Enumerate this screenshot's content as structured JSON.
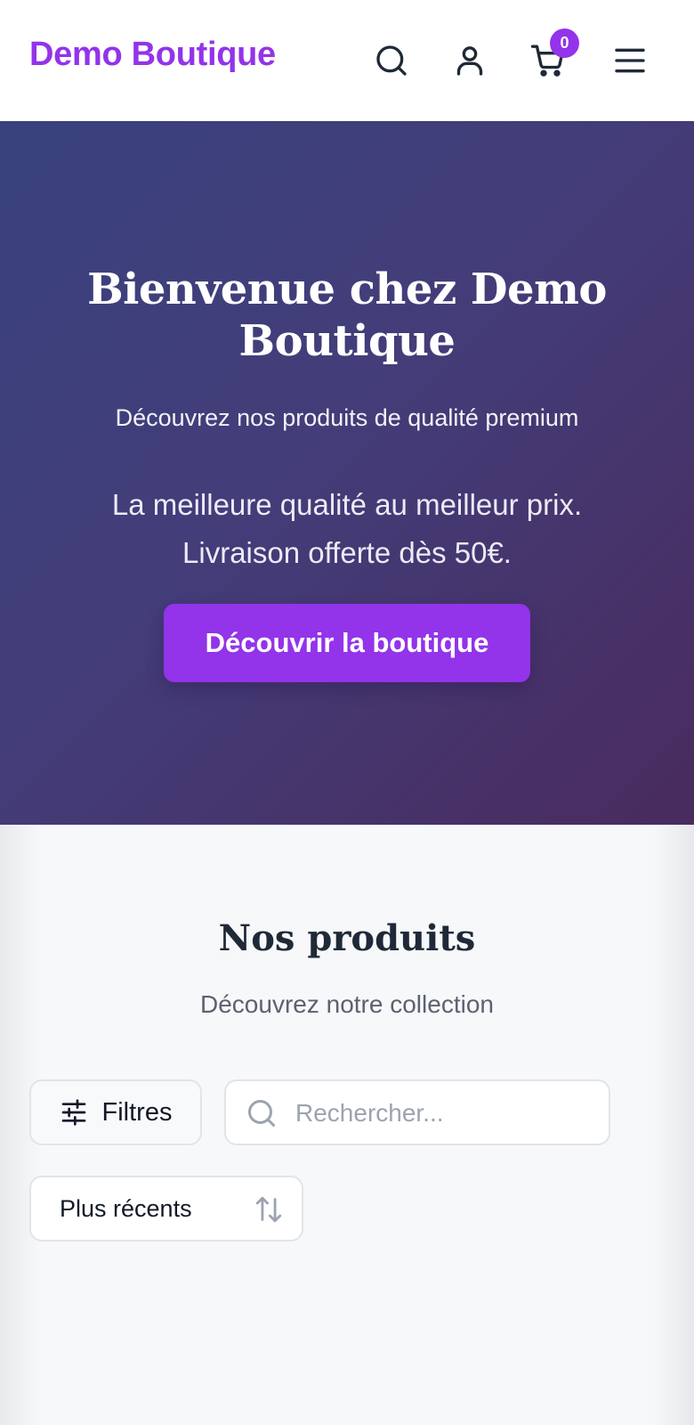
{
  "header": {
    "brand": "Demo Boutique",
    "cart_count": "0",
    "icons": [
      "search-icon",
      "user-icon",
      "cart-icon",
      "menu-icon"
    ]
  },
  "hero": {
    "title": "Bienvenue chez Demo Boutique",
    "subtitle": "Découvrez nos produits de qualité premium",
    "text": "La meilleure qualité au meilleur prix. Livraison offerte dès 50€.",
    "cta_label": "Découvrir la boutique"
  },
  "products": {
    "title": "Nos produits",
    "subtitle": "Découvrez notre collection",
    "filters_label": "Filtres",
    "search_placeholder": "Rechercher...",
    "search_value": "",
    "sort_selected": "Plus récents"
  },
  "colors": {
    "accent": "#9333ea",
    "hero_gradient_start": "#39427e",
    "hero_gradient_end": "#492b5e",
    "text_dark": "#1f2937",
    "muted": "#5b6270",
    "page_bg": "#f7f8fa"
  }
}
